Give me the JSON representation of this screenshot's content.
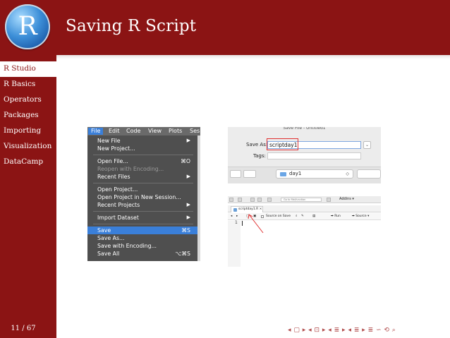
{
  "logo": {
    "letter": "R"
  },
  "header": {
    "title": "Saving R Script"
  },
  "sidebar": {
    "items": [
      {
        "label": "R Studio",
        "active": true
      },
      {
        "label": "R Basics",
        "active": false
      },
      {
        "label": "Operators",
        "active": false
      },
      {
        "label": "Packages",
        "active": false
      },
      {
        "label": "Importing",
        "active": false
      },
      {
        "label": "Visualization",
        "active": false
      },
      {
        "label": "DataCamp",
        "active": false
      }
    ],
    "page_number": "11 / 67"
  },
  "file_menu": {
    "menubar": [
      "File",
      "Edit",
      "Code",
      "View",
      "Plots",
      "Ses"
    ],
    "items": {
      "new_file": "New File",
      "new_project": "New Project...",
      "open_file": "Open File...",
      "open_file_shortcut": "⌘O",
      "reopen_encoding": "Reopen with Encoding...",
      "recent_files": "Recent Files",
      "open_project": "Open Project...",
      "open_project_new_session": "Open Project in New Session...",
      "recent_projects": "Recent Projects",
      "import_dataset": "Import Dataset",
      "save": "Save",
      "save_shortcut": "⌘S",
      "save_as": "Save As...",
      "save_with_encoding": "Save with Encoding...",
      "save_all": "Save All",
      "save_all_shortcut": "⌥⌘S",
      "submenu_arrow": "▶"
    }
  },
  "save_dialog": {
    "title": "Save File - Untitled1",
    "save_as_label": "Save As:",
    "save_as_value": "scriptday1",
    "tags_label": "Tags:",
    "folder": "day1",
    "expand_symbol": "⌄",
    "folder_arrows": "◇"
  },
  "editor": {
    "goto_placeholder": "Go to file/function",
    "addins": "Addins ▾",
    "tab_label": "scriptday1.R ×",
    "source_on_save": "Source on Save",
    "run_label": "➡ Run",
    "source_label": "➡ Source ▾",
    "line_number": "1"
  },
  "footer": {
    "nav_symbols": "◂ ▢ ▸ ◂ ⊡ ▸ ◂ ≣ ▸ ◂ ≣ ▸ ≣ ∽ ⟲ ⌕"
  },
  "colors": {
    "theme": "#8b1414",
    "menu_highlight": "#3a7fd9",
    "highlight_box": "#e03030"
  }
}
